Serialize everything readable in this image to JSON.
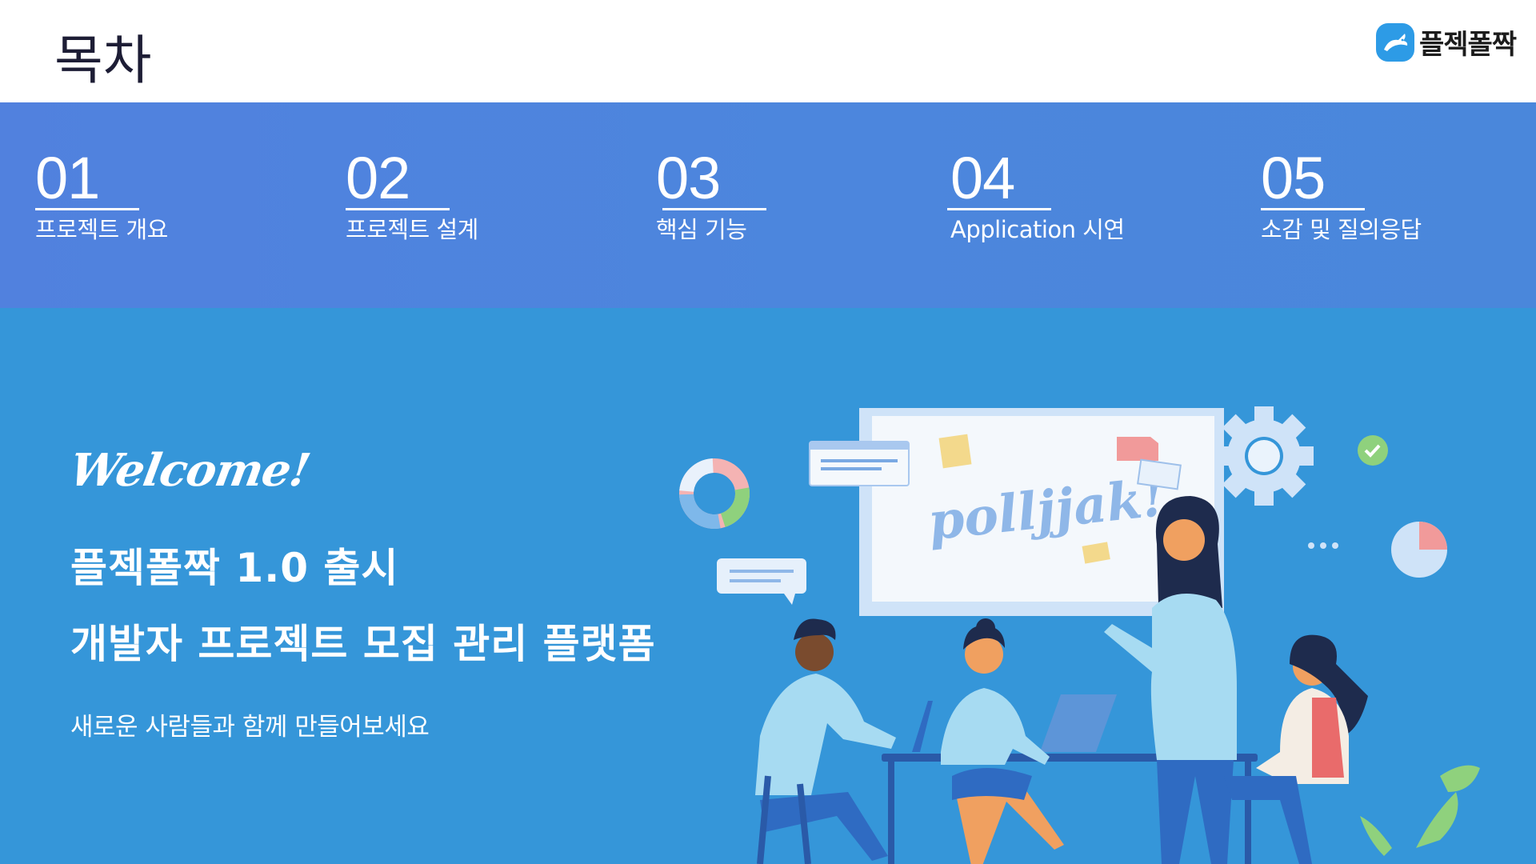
{
  "header": {
    "title": "목차",
    "logo_text": "플젝폴짝"
  },
  "toc": {
    "items": [
      {
        "number": "01",
        "label": "프로젝트 개요"
      },
      {
        "number": "02",
        "label": "프로젝트 설계"
      },
      {
        "number": "03",
        "label": "핵심 기능"
      },
      {
        "number": "04",
        "label": "Application 시연"
      },
      {
        "number": "05",
        "label": "소감 및 질의응답"
      }
    ]
  },
  "hero": {
    "welcome": "Welcome!",
    "line1": "플젝폴짝 1.0 출시",
    "line2": "개발자 프로젝트 모집 관리 플랫폼",
    "subtitle": "새로운 사람들과 함께 만들어보세요",
    "board_text": "polljjak!"
  },
  "colors": {
    "toc_band": "#4f84dd",
    "hero_bg": "#3596d9",
    "logo_mark": "#2d9be6"
  },
  "icons": [
    "rabbit-logo-icon",
    "gear-icon",
    "check-icon",
    "pie-chart-icon",
    "donut-chart-icon",
    "note-icon",
    "chat-bubble-icon"
  ]
}
